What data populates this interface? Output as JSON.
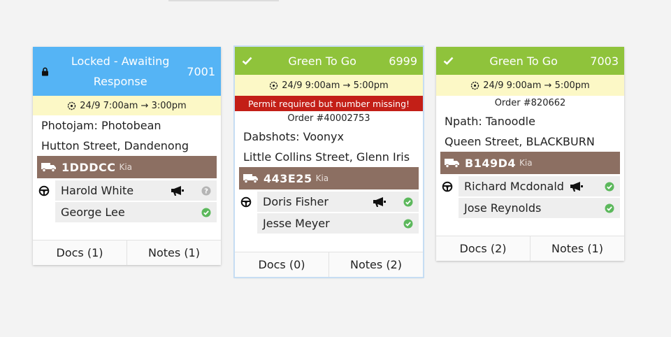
{
  "cards": [
    {
      "status": "locked",
      "header_lines": [
        "Locked - Awaiting",
        "Response"
      ],
      "number": "7001",
      "time_range": "24/9 7:00am → 3:00pm",
      "warning": "",
      "order": "",
      "client": "Photojam: Photobean",
      "address": "Hutton Street, Dandenong",
      "vehicle": {
        "rego": "1DDDCC",
        "make": "Kia"
      },
      "people": [
        {
          "name": "Harold White",
          "driver": true,
          "megaphone": true,
          "status": "unknown"
        },
        {
          "name": "George Lee",
          "driver": false,
          "megaphone": false,
          "status": "ok"
        }
      ],
      "docs_label": "Docs (1)",
      "notes_label": "Notes (1)",
      "selected": false
    },
    {
      "status": "go",
      "header_lines": [
        "Green To Go"
      ],
      "number": "6999",
      "time_range": "24/9 9:00am → 5:00pm",
      "warning": "Permit required but number missing!",
      "order": "Order #40002753",
      "client": "Dabshots: Voonyx",
      "address": "Little Collins Street, Glenn Iris",
      "vehicle": {
        "rego": "443E25",
        "make": "Kia"
      },
      "people": [
        {
          "name": "Doris Fisher",
          "driver": true,
          "megaphone": true,
          "status": "ok"
        },
        {
          "name": "Jesse Meyer",
          "driver": false,
          "megaphone": false,
          "status": "ok"
        }
      ],
      "docs_label": "Docs (0)",
      "notes_label": "Notes (2)",
      "selected": true
    },
    {
      "status": "go",
      "header_lines": [
        "Green To Go"
      ],
      "number": "7003",
      "time_range": "24/9 9:00am → 5:00pm",
      "warning": "",
      "order": "Order #820662",
      "client": "Npath: Tanoodle",
      "address": "Queen Street, BLACKBURN",
      "vehicle": {
        "rego": "B149D4",
        "make": "Kia"
      },
      "people": [
        {
          "name": "Richard Mcdonald",
          "driver": true,
          "megaphone": true,
          "status": "ok"
        },
        {
          "name": "Jose Reynolds",
          "driver": false,
          "megaphone": false,
          "status": "ok"
        }
      ],
      "docs_label": "Docs (2)",
      "notes_label": "Notes (1)",
      "selected": false
    }
  ],
  "colors": {
    "locked_header": "#55b4f5",
    "go_header": "#8fc33b",
    "time_bar": "#fcf8c6",
    "warning": "#c31f17",
    "vehicle_bar": "#8c6f62",
    "ok": "#5cb85c",
    "unknown": "#b5b5b5"
  }
}
